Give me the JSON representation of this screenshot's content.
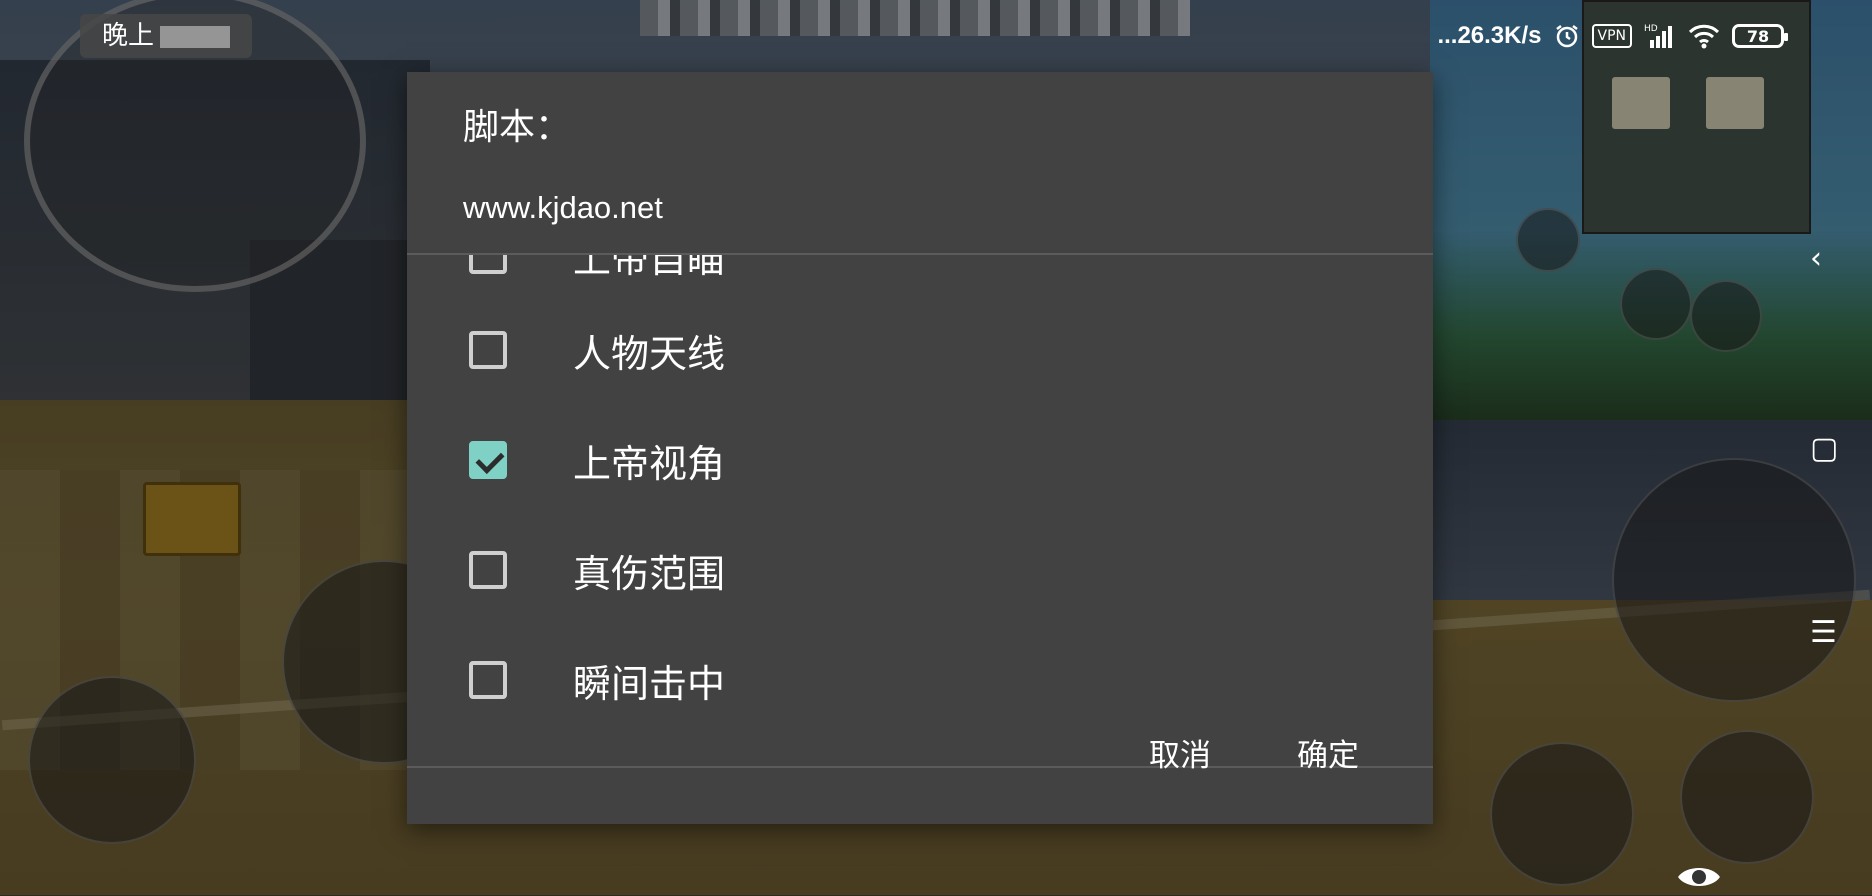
{
  "status_bar": {
    "time_label": "晚上",
    "net_speed": "...26.3K/s",
    "vpn_label": "VPN",
    "signal_label": "HD",
    "battery": "78"
  },
  "dialog": {
    "title": "脚本：",
    "subtitle": "www.kjdao.net",
    "items": [
      {
        "label": "上帝自瞄",
        "checked": false
      },
      {
        "label": "人物天线",
        "checked": false
      },
      {
        "label": "上帝视角",
        "checked": true
      },
      {
        "label": "真伤范围",
        "checked": false
      },
      {
        "label": "瞬间击中",
        "checked": false
      }
    ],
    "cancel_label": "取消",
    "ok_label": "确定"
  },
  "accent_color": "#7fd1c5",
  "dialog_bg_color": "#424242"
}
